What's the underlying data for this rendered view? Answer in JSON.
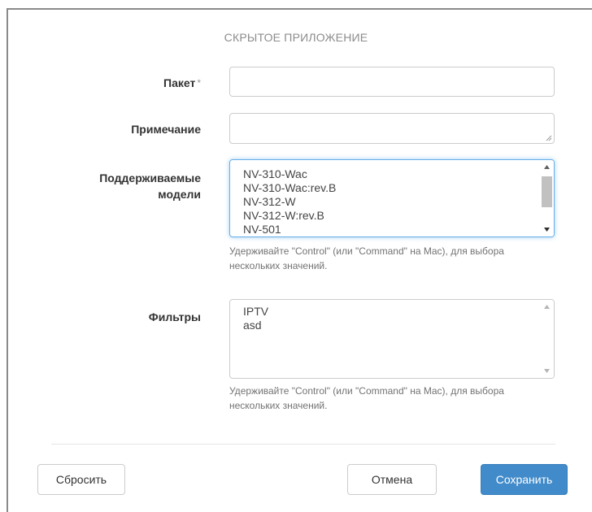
{
  "dialog": {
    "title": "СКРЫТОЕ ПРИЛОЖЕНИЕ"
  },
  "form": {
    "package": {
      "label": "Пакет",
      "required_mark": "*",
      "value": ""
    },
    "note": {
      "label": "Примечание",
      "value": ""
    },
    "models": {
      "label_line1": "Поддерживаемые",
      "label_line2": "модели",
      "options": [
        "NV-310-Wac",
        "NV-310-Wac:rev.B",
        "NV-312-W",
        "NV-312-W:rev.B",
        "NV-501"
      ],
      "help": "Удерживайте \"Control\" (или \"Command\" на Mac), для выбора нескольких значений."
    },
    "filters": {
      "label": "Фильтры",
      "options": [
        "IPTV",
        "asd"
      ],
      "help": "Удерживайте \"Control\" (или \"Command\" на Mac), для выбора нескольких значений."
    }
  },
  "footer": {
    "reset_label": "Сбросить",
    "cancel_label": "Отмена",
    "save_label": "Сохранить"
  },
  "colors": {
    "primary": "#428bca",
    "focus": "#66afe9",
    "muted": "#8c8c8c"
  }
}
